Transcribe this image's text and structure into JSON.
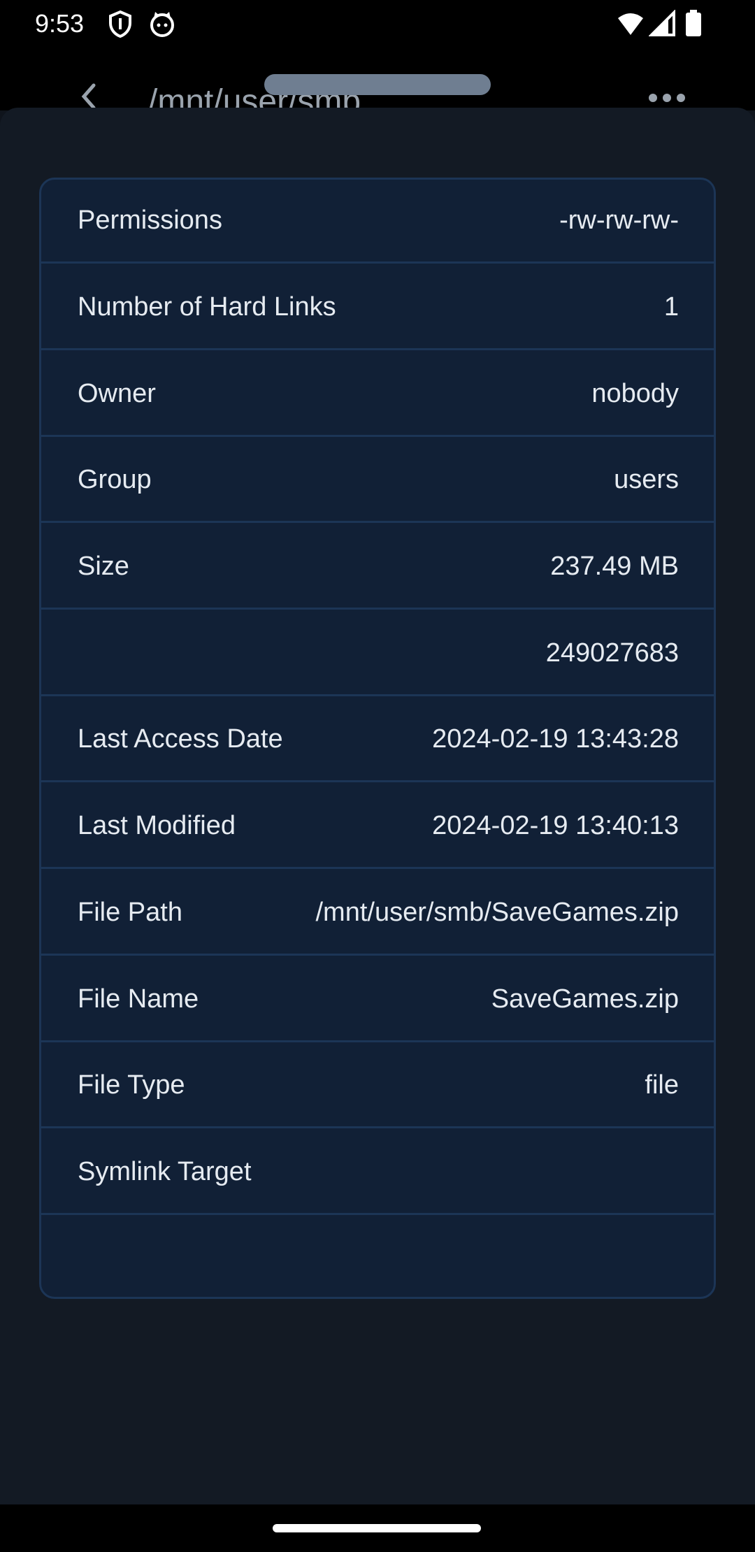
{
  "status_bar": {
    "time": "9:53",
    "icons": [
      "shield-icon",
      "cat-icon",
      "wifi-icon",
      "signal-icon",
      "battery-icon"
    ]
  },
  "app_bar": {
    "title": "/mnt/user/smb",
    "back_icon": "chevron-left-icon",
    "more_icon": "more-horizontal-icon"
  },
  "properties": {
    "rows": [
      {
        "label": "Permissions",
        "value": "-rw-rw-rw-"
      },
      {
        "label": "Number of Hard Links",
        "value": "1"
      },
      {
        "label": "Owner",
        "value": "nobody"
      },
      {
        "label": "Group",
        "value": "users"
      },
      {
        "label": "Size",
        "value": "237.49 MB"
      },
      {
        "label": "",
        "value": "249027683"
      },
      {
        "label": "Last Access Date",
        "value": "2024-02-19 13:43:28"
      },
      {
        "label": "Last Modified",
        "value": "2024-02-19 13:40:13"
      },
      {
        "label": "File Path",
        "value": "/mnt/user/smb/SaveGames.zip"
      },
      {
        "label": "File Name",
        "value": "SaveGames.zip"
      },
      {
        "label": "File Type",
        "value": "file"
      },
      {
        "label": "Symlink Target",
        "value": ""
      },
      {
        "label": "",
        "value": ""
      }
    ]
  },
  "colors": {
    "sheet_background": "#131a24",
    "table_background": "#112036",
    "table_border": "#1c3556",
    "text": "#e6ebf1"
  }
}
